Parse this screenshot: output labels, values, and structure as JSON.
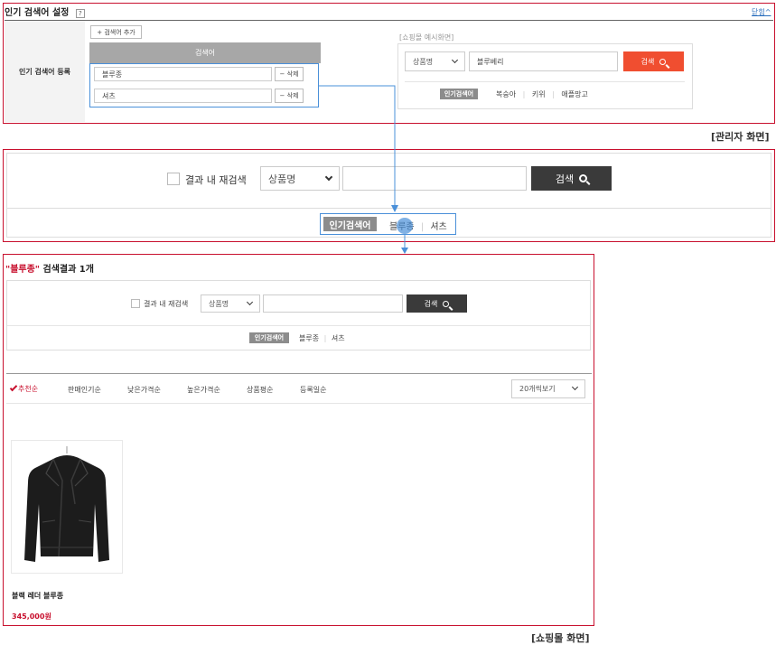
{
  "admin": {
    "title": "인기 검색어 설정",
    "help": "?",
    "collapse_label": "닫힘^",
    "row_label": "인기 검색어 등록",
    "add_button": "+ 검색어 추가",
    "column_header": "검색어",
    "keywords": [
      {
        "value": "블루종",
        "delete_label": "− 삭제"
      },
      {
        "value": "셔츠",
        "delete_label": "− 삭제"
      }
    ],
    "preview": {
      "title": "[쇼핑몰 예시화면]",
      "select_value": "상품명",
      "input_value": "블루베리",
      "search_label": "검색",
      "popular_label": "인기검색어",
      "keywords": [
        "복숭아",
        "키위",
        "애플망고"
      ]
    }
  },
  "admin_caption": "[관리자 화면]",
  "mall_search": {
    "rescan_label": "결과 내 재검색",
    "select_value": "상품명",
    "search_label": "검색",
    "popular_label": "인기검색어",
    "keywords": [
      "블루종",
      "셔츠"
    ]
  },
  "results": {
    "query": "\"블루종\"",
    "title_suffix": " 검색결과 1개",
    "rescan_label": "결과 내 재검색",
    "select_value": "상품명",
    "search_label": "검색",
    "popular_label": "인기검색어",
    "keywords": [
      "블루종",
      "셔츠"
    ],
    "sort_options": [
      "추천순",
      "판매인기순",
      "낮은가격순",
      "높은가격순",
      "상품평순",
      "등록일순"
    ],
    "view_option": "20개씩보기",
    "product": {
      "name": "블랙 레더 블루종",
      "price": "345,000원"
    }
  },
  "mall_caption": "[쇼핑몰 화면]",
  "colors": {
    "accent_red": "#c8102e",
    "search_orange": "#f04e30",
    "connector_blue": "#4a90d9",
    "dark_button": "#3a3a3a"
  }
}
